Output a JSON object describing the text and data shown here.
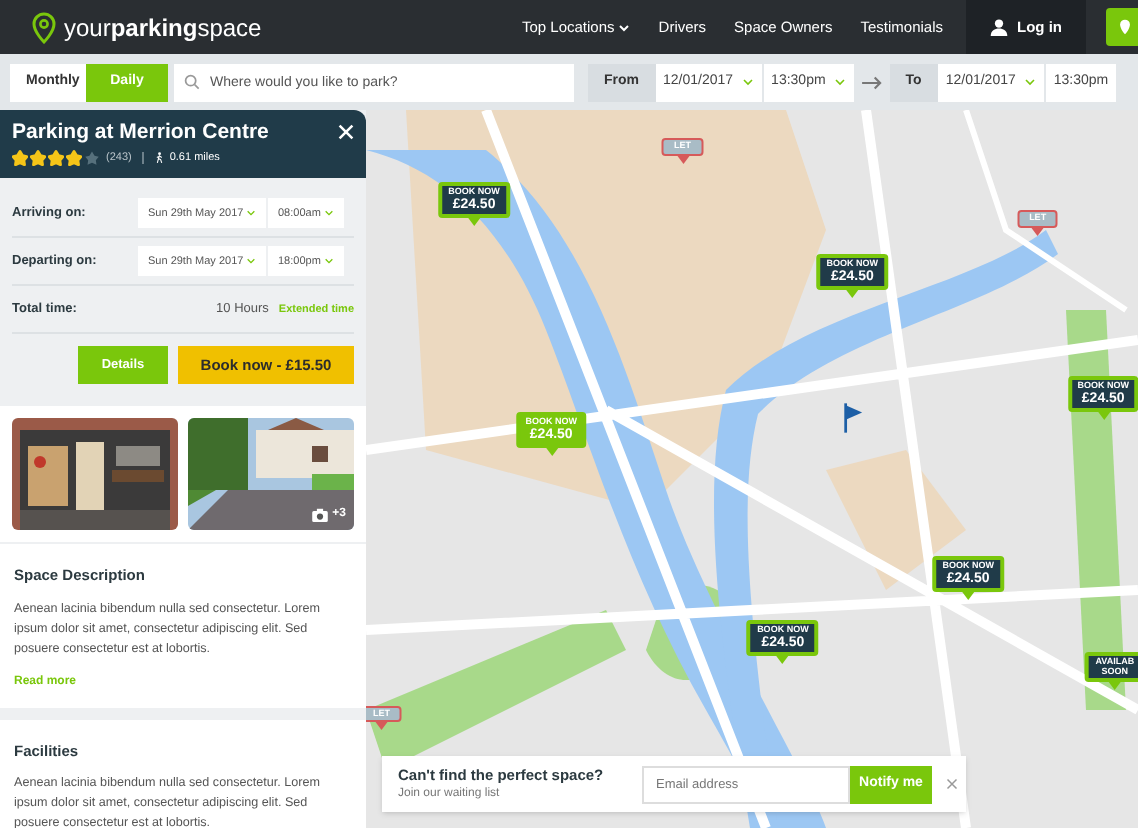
{
  "header": {
    "logo": {
      "prefix": "your",
      "bold": "parking",
      "suffix": "space"
    },
    "nav": [
      {
        "label": "Top Locations",
        "dropdown": true
      },
      {
        "label": "Drivers",
        "dropdown": false
      },
      {
        "label": "Space Owners",
        "dropdown": false
      },
      {
        "label": "Testimonials",
        "dropdown": false
      }
    ],
    "login": "Log in"
  },
  "search_bar": {
    "tabs": [
      {
        "label": "Monthly",
        "selected": false
      },
      {
        "label": "Daily",
        "selected": true
      }
    ],
    "search": {
      "placeholder": "Where would you like to park?"
    },
    "from": {
      "label": "From",
      "date": "12/01/2017",
      "time": "13:30pm"
    },
    "to": {
      "label": "To",
      "date": "12/01/2017",
      "time": "13:30pm"
    }
  },
  "listing": {
    "title": "Parking at Merrion Centre",
    "stars": 4,
    "reviews": "(243)",
    "distance": "0.61 miles",
    "rows": [
      {
        "label": "Arriving on:",
        "date": "Sun 29th May 2017",
        "time": "08:00am"
      },
      {
        "label": "Departing on:",
        "date": "Sun 29th May 2017",
        "time": "18:00pm"
      }
    ],
    "total": {
      "label": "Total time:",
      "value": "10 Hours",
      "link": "Extended time"
    },
    "details_button": "Details",
    "book_button": "Book now - £15.50",
    "photo_count": "+3",
    "sections": [
      {
        "heading": "Space Description",
        "text": "Aenean lacinia bibendum nulla sed consectetur. Lorem ipsum dolor sit amet, consectetur adipiscing elit. Sed posuere consectetur est at lobortis.",
        "link": "Read more"
      },
      {
        "heading": "Facilities",
        "text": "Aenean lacinia bibendum nulla sed consectetur. Lorem ipsum dolor sit amet, consectetur adipiscing elit. Sed posuere consectetur est at lobortis."
      }
    ]
  },
  "map": {
    "markers": [
      {
        "kind": "let",
        "lines": [
          "LET"
        ]
      },
      {
        "kind": "book",
        "lines": [
          "BOOK NOW",
          "£24.50"
        ],
        "selected": false
      },
      {
        "kind": "book",
        "lines": [
          "BOOK NOW",
          "£24.50"
        ],
        "selected": false
      },
      {
        "kind": "let",
        "lines": [
          "LET"
        ]
      },
      {
        "kind": "book",
        "lines": [
          "BOOK NOW",
          "£24.50"
        ],
        "selected": true
      },
      {
        "kind": "book",
        "lines": [
          "BOOK NOW",
          "£24.50"
        ],
        "selected": false
      },
      {
        "kind": "book",
        "lines": [
          "BOOK NOW",
          "£24.50"
        ],
        "selected": false
      },
      {
        "kind": "book",
        "lines": [
          "BOOK NOW",
          "£24.50"
        ],
        "selected": false
      },
      {
        "kind": "soon",
        "lines": [
          "AVAILAB",
          "SOON"
        ]
      },
      {
        "kind": "let",
        "lines": [
          "LET"
        ]
      }
    ],
    "waiting_list": {
      "title": "Can't find the perfect space?",
      "subtitle": "Join our waiting list",
      "placeholder": "Email address",
      "button": "Notify me"
    }
  }
}
